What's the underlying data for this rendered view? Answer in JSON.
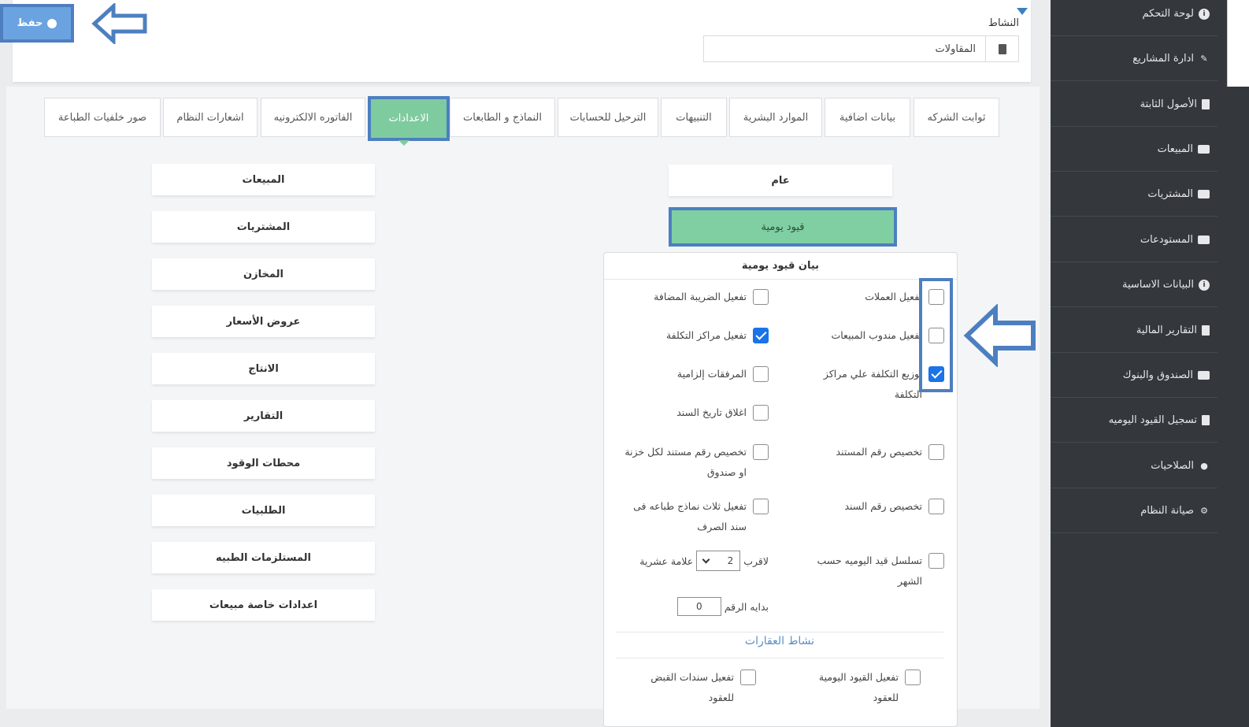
{
  "header": {
    "save_label": "حفظ",
    "activity_label": "النشاط",
    "activity_value": "المقاولات"
  },
  "sidebar": {
    "items": [
      {
        "label": "لوحة التحكم",
        "icon": "dashboard-icon"
      },
      {
        "label": "ادارة المشاريع",
        "icon": "handshake-icon"
      },
      {
        "label": "الأصول الثابتة",
        "icon": "document-icon"
      },
      {
        "label": "المبيعات",
        "icon": "truck-icon"
      },
      {
        "label": "المشتريات",
        "icon": "money-icon"
      },
      {
        "label": "المستودعات",
        "icon": "archive-icon"
      },
      {
        "label": "البيانات الاساسية",
        "icon": "info-icon"
      },
      {
        "label": "التقارير المالية",
        "icon": "document-icon"
      },
      {
        "label": "الصندوق والبنوك",
        "icon": "money-icon"
      },
      {
        "label": "تسجيل القيود اليوميه",
        "icon": "document-icon"
      },
      {
        "label": "الصلاحيات",
        "icon": "user-lock-icon"
      },
      {
        "label": "صيانة النظام",
        "icon": "gear-icon"
      }
    ]
  },
  "tabs": [
    {
      "label": "ثوابت الشركه"
    },
    {
      "label": "بيانات اضافية"
    },
    {
      "label": "الموارد البشرية"
    },
    {
      "label": "التنبيهات"
    },
    {
      "label": "الترحيل للحسابات"
    },
    {
      "label": "النماذج و الطابعات"
    },
    {
      "label": "الاعدادات",
      "active": true
    },
    {
      "label": "الفاتوره الالكترونيه"
    },
    {
      "label": "اشعارات النظام"
    },
    {
      "label": "صور خلفيات الطباعة"
    }
  ],
  "left_menu": [
    "المبيعات",
    "المشتريات",
    "المخازن",
    "عروض الأسعار",
    "الانتاج",
    "التقارير",
    "محطات الوقود",
    "الطلبيات",
    "المستلزمات الطبيه",
    "اعدادات خاصة مبيعات"
  ],
  "settings": {
    "general_label": "عام",
    "journal_label": "قيود يومية",
    "panel_title": "بيان قيود يومية",
    "options_right": [
      {
        "label": "تفعيل العملات",
        "checked": false
      },
      {
        "label": "تفعيل مندوب المبيعات",
        "checked": false
      },
      {
        "label": "توزيع التكلفة علي مراكز التكلفة",
        "checked": true
      },
      {
        "label": "تخصيص رقم المستند",
        "checked": false
      },
      {
        "label": "تخصيص رقم السند",
        "checked": false
      },
      {
        "label": "تسلسل قيد اليوميه حسب الشهر",
        "checked": false
      }
    ],
    "options_left": [
      {
        "label": "تفعيل الضريبة المضافة",
        "checked": false
      },
      {
        "label": "تفعيل مراكز التكلفة",
        "checked": true
      },
      {
        "label": "المرفقات إلزامية",
        "checked": false
      },
      {
        "label": "اغلاق تاريخ السند",
        "checked": false
      },
      {
        "label": "تخصيص رقم مستند لكل خزنة او صندوق",
        "checked": false
      },
      {
        "label": "تفعيل ثلاث نماذج طباعه فى سند الصرف",
        "checked": false
      }
    ],
    "rounding_prefix": "لاقرب",
    "rounding_value": "2",
    "rounding_suffix": "علامة عشرية",
    "start_number_label": "بدايه الرقم",
    "start_number_value": "0",
    "realestate_title": "نشاط العقارات",
    "realestate_options": [
      {
        "label": "تفعيل القيود اليومية للعقود",
        "checked": false
      },
      {
        "label": "تفعيل سندات القبض للعقود",
        "checked": false
      }
    ]
  },
  "colors": {
    "sidebar_bg": "#34383d",
    "highlight_frame": "#4d7fc0",
    "active_green": "#7fcba0",
    "checkbox_blue": "#1a73e8",
    "section_title_blue": "#5b8fc6"
  }
}
